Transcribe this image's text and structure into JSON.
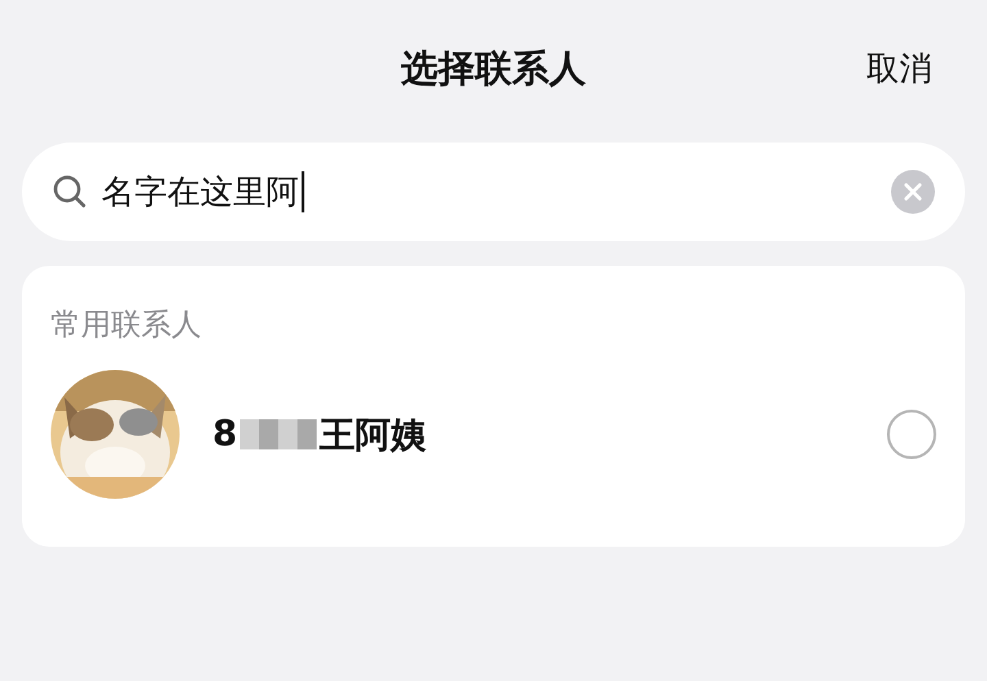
{
  "header": {
    "title": "选择联系人",
    "cancel": "取消"
  },
  "search": {
    "value": "名字在这里阿"
  },
  "section": {
    "title": "常用联系人",
    "contacts": [
      {
        "name_start": "8",
        "name_end": "王阿姨",
        "redacted": true,
        "selected": false
      }
    ]
  }
}
